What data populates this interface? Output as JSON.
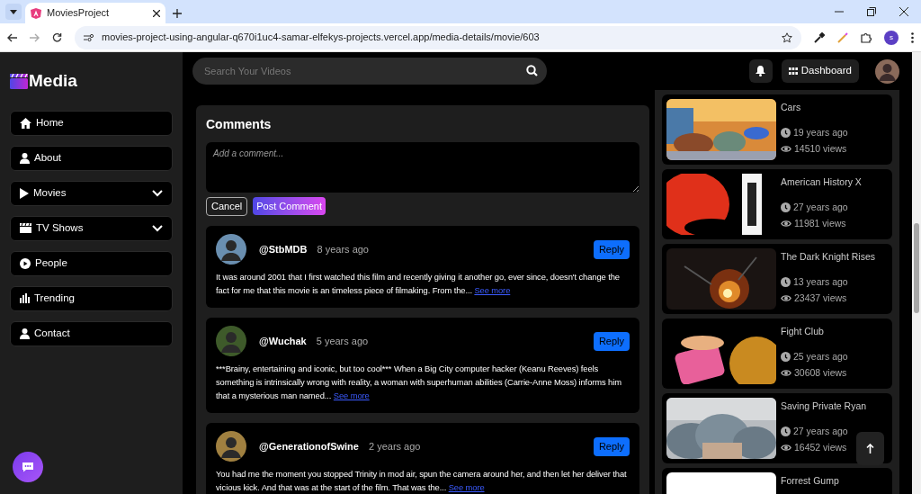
{
  "browser": {
    "tab_title": "MoviesProject",
    "url": "movies-project-using-angular-q670i1uc4-samar-elfekys-projects.vercel.app/media-details/movie/603",
    "profile_initial": "s"
  },
  "brand": "Media",
  "sidebar": {
    "items": [
      {
        "label": "Home",
        "kind": "link"
      },
      {
        "label": "About",
        "kind": "link"
      },
      {
        "label": "Movies",
        "kind": "dropdown"
      },
      {
        "label": "TV Shows",
        "kind": "dropdown"
      },
      {
        "label": "People",
        "kind": "link"
      },
      {
        "label": "Trending",
        "kind": "link"
      },
      {
        "label": "Contact",
        "kind": "link"
      }
    ]
  },
  "search": {
    "placeholder": "Search Your Videos"
  },
  "header": {
    "dashboard": "Dashboard"
  },
  "comments": {
    "title": "Comments",
    "placeholder": "Add a comment...",
    "cancel": "Cancel",
    "post": "Post Comment",
    "items": [
      {
        "author": "@StbMDB",
        "time": "8 years ago",
        "reply": "Reply",
        "text": "It was around 2001 that I first watched this film and recently giving it another go, ever since, doesn't change the fact for me that this movie is an timeless piece of filmaking. From the...",
        "more": "See more"
      },
      {
        "author": "@Wuchak",
        "time": "5 years ago",
        "reply": "Reply",
        "text": "***Brainy, entertaining and iconic, but too cool*** When a Big City computer hacker (Keanu Reeves) feels something is intrinsically wrong with reality, a woman with superhuman abilities (Carrie-Anne Moss) informs him that a mysterious man named...",
        "more": "See more"
      },
      {
        "author": "@GenerationofSwine",
        "time": "2 years ago",
        "reply": "Reply",
        "text": "You had me the moment you stopped Trinity in mod air, spun the camera around her, and then let her deliver that vicious kick. And that was at the start of the film. That was the...",
        "more": "See more"
      }
    ]
  },
  "related": [
    {
      "title": "Cars",
      "time": "19 years ago",
      "views": "14510 views"
    },
    {
      "title": "American History X",
      "time": "27 years ago",
      "views": "11981 views"
    },
    {
      "title": "The Dark Knight Rises",
      "time": "13 years ago",
      "views": "23437 views"
    },
    {
      "title": "Fight Club",
      "time": "25 years ago",
      "views": "30608 views"
    },
    {
      "title": "Saving Private Ryan",
      "time": "27 years ago",
      "views": "16452 views"
    },
    {
      "title": "Forrest Gump"
    }
  ]
}
